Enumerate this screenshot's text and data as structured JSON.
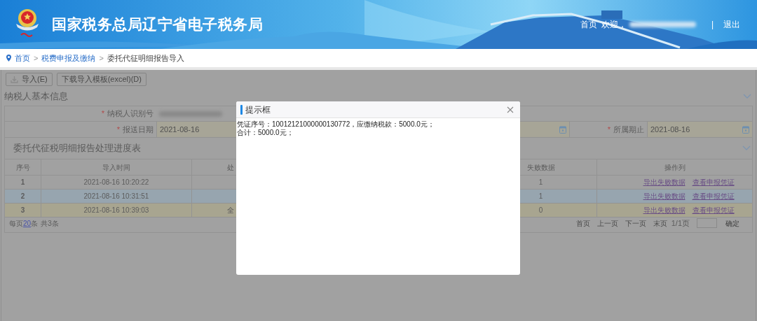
{
  "header": {
    "title": "国家税务总局辽宁省电子税务局",
    "nav": {
      "home": "首页",
      "welcome": "欢迎，",
      "separator": "|",
      "logout": "退出"
    }
  },
  "breadcrumb": [
    {
      "label": "首页",
      "link": true
    },
    {
      "label": "税费申报及缴纳",
      "link": true
    },
    {
      "label": "委托代征明细报告导入",
      "link": false
    }
  ],
  "breadcrumb_separator": ">",
  "toolbar": [
    {
      "label": "导入(E)",
      "kind": "icon_button"
    },
    {
      "label": "下载导入模板(excel)(D)",
      "kind": "button"
    }
  ],
  "taxpayer_section": {
    "title": "纳税人基本信息",
    "expanded": true,
    "required_mark": "*",
    "fields": [
      {
        "label": "纳税人识别号",
        "required": true,
        "kind": "redacted"
      },
      {
        "label": "报送日期",
        "required": true,
        "kind": "date",
        "value": "2021-08-16"
      },
      {
        "label": "所属期止",
        "required": true,
        "kind": "date",
        "value": "2021-08-16"
      }
    ]
  },
  "progress_section": {
    "title": "委托代征税明细报告处理进度表",
    "expanded": true,
    "columns": [
      "序号",
      "导入时间",
      "处",
      "失败数据",
      "操作列"
    ],
    "rows": [
      {
        "no": "1",
        "time": "2021-08-16 10:20:22",
        "failed": "1",
        "actions": [
          "导出失败数据",
          "查看申报凭证"
        ],
        "selected": false,
        "hovered": false
      },
      {
        "no": "2",
        "time": "2021-08-16 10:31:51",
        "failed": "1",
        "actions": [
          "导出失败数据",
          "查看申报凭证"
        ],
        "selected": false,
        "hovered": true
      },
      {
        "no": "3",
        "time": "2021-08-16 10:39:03",
        "column_3": "全",
        "failed": "0",
        "actions": [
          "导出失败数据",
          "查看申报凭证"
        ],
        "selected": true,
        "hovered": false
      }
    ]
  },
  "pagination": {
    "prefix": "每页",
    "page_size": "20",
    "suffix": "条",
    "total": "共3条",
    "buttons": [
      "首页",
      "上一页",
      "下一页",
      "末页"
    ],
    "page_info": "1/1页",
    "confirm": "确定"
  },
  "dialog": {
    "title": "提示框",
    "lines": [
      "凭证序号：10012121000000130772，应缴纳税款：5000.0元；",
      "合计：5000.0元；"
    ]
  }
}
